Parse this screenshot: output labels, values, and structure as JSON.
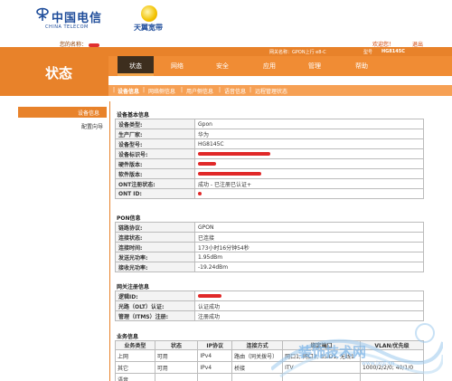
{
  "header": {
    "logo_cn": "中国电信",
    "logo_en": "CHINA TELECOM",
    "brand_tianyi": "天翼宽带",
    "welcome_prefix": "您的名称：",
    "gateway_label": "网关名称：GPON上行 e8-C",
    "model_label": "型号",
    "model_value": "HG8145C",
    "welcome_link": "欢迎您！",
    "logout_link": "退出"
  },
  "page_title": "状态",
  "main_tabs": [
    {
      "label": "状态",
      "active": true
    },
    {
      "label": "网络",
      "active": false
    },
    {
      "label": "安全",
      "active": false
    },
    {
      "label": "应用",
      "active": false
    },
    {
      "label": "管理",
      "active": false
    },
    {
      "label": "帮助",
      "active": false
    }
  ],
  "sub_tabs": [
    {
      "label": "设备信息"
    },
    {
      "label": "网络侧信息"
    },
    {
      "label": "用户侧信息"
    },
    {
      "label": "语音信息"
    },
    {
      "label": "远程管理状态"
    }
  ],
  "sidebar": {
    "items": [
      {
        "label": "设备信息",
        "active": true
      },
      {
        "label": "配置向导",
        "active": false
      }
    ]
  },
  "device_info": {
    "title": "设备基本信息",
    "rows": [
      {
        "key": "设备类型:",
        "value": "Gpon"
      },
      {
        "key": "生产厂家:",
        "value": "华为"
      },
      {
        "key": "设备型号:",
        "value": "HG8145C"
      },
      {
        "key": "设备标识号:",
        "value": ""
      },
      {
        "key": "硬件版本:",
        "value": ""
      },
      {
        "key": "软件版本:",
        "value": ""
      },
      {
        "key": "ONT注册状态:",
        "value": "成功 - 已注册已认证+"
      },
      {
        "key": "ONT ID:",
        "value": ""
      }
    ]
  },
  "pon_info": {
    "title": "PON信息",
    "rows": [
      {
        "key": "链路协议:",
        "value": "GPON"
      },
      {
        "key": "连接状态:",
        "value": "已连接"
      },
      {
        "key": "连接时间:",
        "value": "173小时16分钟54秒"
      },
      {
        "key": "发送光功率:",
        "value": "1.95dBm"
      },
      {
        "key": "接收光功率:",
        "value": "-19.24dBm"
      }
    ]
  },
  "gateway_reg": {
    "title": "网关注册信息",
    "rows": [
      {
        "key": "逻辑ID:",
        "value": ""
      },
      {
        "key": "光路（OLT）认证:",
        "value": "认证成功"
      },
      {
        "key": "管理（ITMS）注册:",
        "value": "注册成功"
      }
    ]
  },
  "service_info": {
    "title": "业务信息",
    "headers": [
      "业务类型",
      "状态",
      "IP协议",
      "连接方式",
      "绑定端口",
      "VLAN/优先级"
    ],
    "rows": [
      {
        "type": "上网",
        "status": "可用",
        "ip": "IPv4",
        "conn": "路由（同关拨号）",
        "ports": "网口1, 网口3, SSID1, 无线1",
        "vlan": ""
      },
      {
        "type": "其它",
        "status": "可用",
        "ip": "IPv4",
        "conn": "桥接",
        "ports": "ITV",
        "vlan": "1000/2/2/0; 40/1/0"
      },
      {
        "type": "语音",
        "status": "",
        "ip": "",
        "conn": "",
        "ports": "",
        "vlan": ""
      }
    ]
  },
  "watermark": {
    "text": "装饰技术网",
    "url": "www.jxgt.cn"
  },
  "colors": {
    "orange": "#e8822a",
    "nav_dark": "#3d2e1e",
    "ct_blue": "#1e4c9a",
    "redact": "#e02828"
  }
}
